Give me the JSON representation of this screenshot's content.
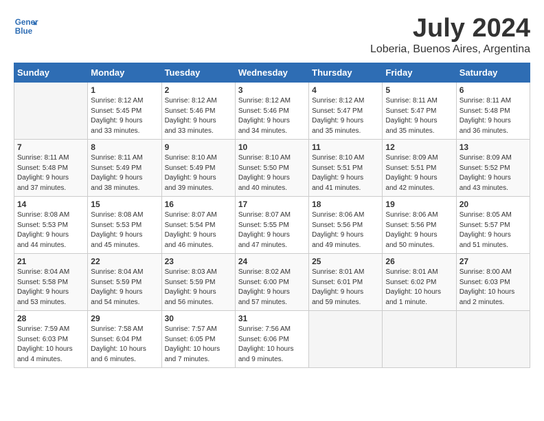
{
  "header": {
    "logo_line1": "General",
    "logo_line2": "Blue",
    "month": "July 2024",
    "location": "Loberia, Buenos Aires, Argentina"
  },
  "days_of_week": [
    "Sunday",
    "Monday",
    "Tuesday",
    "Wednesday",
    "Thursday",
    "Friday",
    "Saturday"
  ],
  "weeks": [
    [
      {
        "day": "",
        "info": ""
      },
      {
        "day": "1",
        "info": "Sunrise: 8:12 AM\nSunset: 5:45 PM\nDaylight: 9 hours\nand 33 minutes."
      },
      {
        "day": "2",
        "info": "Sunrise: 8:12 AM\nSunset: 5:46 PM\nDaylight: 9 hours\nand 33 minutes."
      },
      {
        "day": "3",
        "info": "Sunrise: 8:12 AM\nSunset: 5:46 PM\nDaylight: 9 hours\nand 34 minutes."
      },
      {
        "day": "4",
        "info": "Sunrise: 8:12 AM\nSunset: 5:47 PM\nDaylight: 9 hours\nand 35 minutes."
      },
      {
        "day": "5",
        "info": "Sunrise: 8:11 AM\nSunset: 5:47 PM\nDaylight: 9 hours\nand 35 minutes."
      },
      {
        "day": "6",
        "info": "Sunrise: 8:11 AM\nSunset: 5:48 PM\nDaylight: 9 hours\nand 36 minutes."
      }
    ],
    [
      {
        "day": "7",
        "info": "Sunrise: 8:11 AM\nSunset: 5:48 PM\nDaylight: 9 hours\nand 37 minutes."
      },
      {
        "day": "8",
        "info": "Sunrise: 8:11 AM\nSunset: 5:49 PM\nDaylight: 9 hours\nand 38 minutes."
      },
      {
        "day": "9",
        "info": "Sunrise: 8:10 AM\nSunset: 5:49 PM\nDaylight: 9 hours\nand 39 minutes."
      },
      {
        "day": "10",
        "info": "Sunrise: 8:10 AM\nSunset: 5:50 PM\nDaylight: 9 hours\nand 40 minutes."
      },
      {
        "day": "11",
        "info": "Sunrise: 8:10 AM\nSunset: 5:51 PM\nDaylight: 9 hours\nand 41 minutes."
      },
      {
        "day": "12",
        "info": "Sunrise: 8:09 AM\nSunset: 5:51 PM\nDaylight: 9 hours\nand 42 minutes."
      },
      {
        "day": "13",
        "info": "Sunrise: 8:09 AM\nSunset: 5:52 PM\nDaylight: 9 hours\nand 43 minutes."
      }
    ],
    [
      {
        "day": "14",
        "info": "Sunrise: 8:08 AM\nSunset: 5:53 PM\nDaylight: 9 hours\nand 44 minutes."
      },
      {
        "day": "15",
        "info": "Sunrise: 8:08 AM\nSunset: 5:53 PM\nDaylight: 9 hours\nand 45 minutes."
      },
      {
        "day": "16",
        "info": "Sunrise: 8:07 AM\nSunset: 5:54 PM\nDaylight: 9 hours\nand 46 minutes."
      },
      {
        "day": "17",
        "info": "Sunrise: 8:07 AM\nSunset: 5:55 PM\nDaylight: 9 hours\nand 47 minutes."
      },
      {
        "day": "18",
        "info": "Sunrise: 8:06 AM\nSunset: 5:56 PM\nDaylight: 9 hours\nand 49 minutes."
      },
      {
        "day": "19",
        "info": "Sunrise: 8:06 AM\nSunset: 5:56 PM\nDaylight: 9 hours\nand 50 minutes."
      },
      {
        "day": "20",
        "info": "Sunrise: 8:05 AM\nSunset: 5:57 PM\nDaylight: 9 hours\nand 51 minutes."
      }
    ],
    [
      {
        "day": "21",
        "info": "Sunrise: 8:04 AM\nSunset: 5:58 PM\nDaylight: 9 hours\nand 53 minutes."
      },
      {
        "day": "22",
        "info": "Sunrise: 8:04 AM\nSunset: 5:59 PM\nDaylight: 9 hours\nand 54 minutes."
      },
      {
        "day": "23",
        "info": "Sunrise: 8:03 AM\nSunset: 5:59 PM\nDaylight: 9 hours\nand 56 minutes."
      },
      {
        "day": "24",
        "info": "Sunrise: 8:02 AM\nSunset: 6:00 PM\nDaylight: 9 hours\nand 57 minutes."
      },
      {
        "day": "25",
        "info": "Sunrise: 8:01 AM\nSunset: 6:01 PM\nDaylight: 9 hours\nand 59 minutes."
      },
      {
        "day": "26",
        "info": "Sunrise: 8:01 AM\nSunset: 6:02 PM\nDaylight: 10 hours\nand 1 minute."
      },
      {
        "day": "27",
        "info": "Sunrise: 8:00 AM\nSunset: 6:03 PM\nDaylight: 10 hours\nand 2 minutes."
      }
    ],
    [
      {
        "day": "28",
        "info": "Sunrise: 7:59 AM\nSunset: 6:03 PM\nDaylight: 10 hours\nand 4 minutes."
      },
      {
        "day": "29",
        "info": "Sunrise: 7:58 AM\nSunset: 6:04 PM\nDaylight: 10 hours\nand 6 minutes."
      },
      {
        "day": "30",
        "info": "Sunrise: 7:57 AM\nSunset: 6:05 PM\nDaylight: 10 hours\nand 7 minutes."
      },
      {
        "day": "31",
        "info": "Sunrise: 7:56 AM\nSunset: 6:06 PM\nDaylight: 10 hours\nand 9 minutes."
      },
      {
        "day": "",
        "info": ""
      },
      {
        "day": "",
        "info": ""
      },
      {
        "day": "",
        "info": ""
      }
    ]
  ]
}
